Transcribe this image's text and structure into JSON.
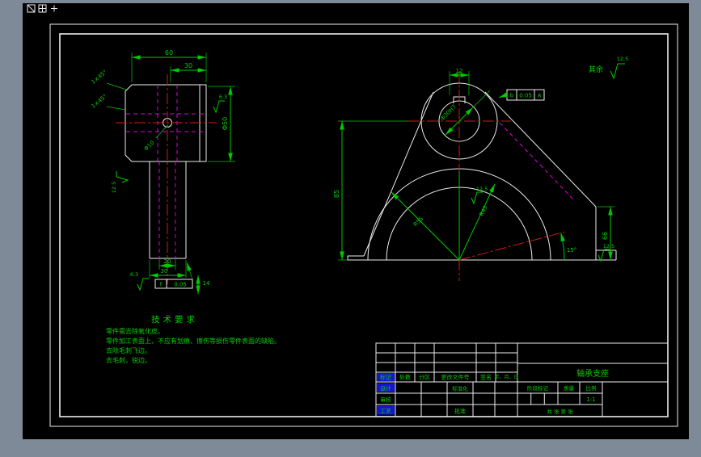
{
  "colors": {
    "background": "#7e8a97",
    "paper": "#000000",
    "outline": "#ececec",
    "dimension": "#00c800",
    "centerline": "#d81616",
    "hidden": "#dd00dd",
    "highlight": "#1515d0"
  },
  "general_note": {
    "label": "其余",
    "value": "12.5"
  },
  "left_view": {
    "dim_width": "60",
    "dim_step": "30",
    "chamfer_top": "1×45°",
    "chamfer_mid": "1×45°",
    "dim_outer": "Φ50",
    "hole_callout": "Φ10",
    "dim_bore": "20",
    "dim_shank": "30",
    "dim_offset": "14",
    "tol_symbol": "f",
    "tol_value": "0.05",
    "rough_head": "6.3",
    "rough_shank": "12.5",
    "rough_bottom": "6.3"
  },
  "right_view": {
    "dim_key": "12",
    "tol_symbol": "b",
    "tol_value": "0.05",
    "tol_datum": "A",
    "bore_callout": "Φ30H7",
    "arch_inner": "R45",
    "arch_outer": "R55",
    "dim_height": "85",
    "dim_right": "66",
    "angle": "15°",
    "rough_arch": "12.5",
    "rough_base": "12.5"
  },
  "tech_req": {
    "title": "技术要求",
    "lines": [
      "零件需去除氧化皮。",
      "零件加工表面上，不应有划痕、擦伤等损伤零件表面的缺陷。",
      "去除毛刺飞边。",
      "去毛刺，锐边。"
    ]
  },
  "title_block": {
    "rev_headers": [
      "标记",
      "处数",
      "分区",
      "更改文件号",
      "签名",
      "年、月、日"
    ],
    "design": "设计",
    "standardization": "标准化",
    "audit": "审核",
    "process": "工艺",
    "approve": "批准",
    "stage_mark": "阶段标记",
    "weight": "质量",
    "scale": "比例",
    "scale_value": "1:1",
    "sheet_note": "共 张 第 张",
    "part_name": "轴承支座"
  }
}
